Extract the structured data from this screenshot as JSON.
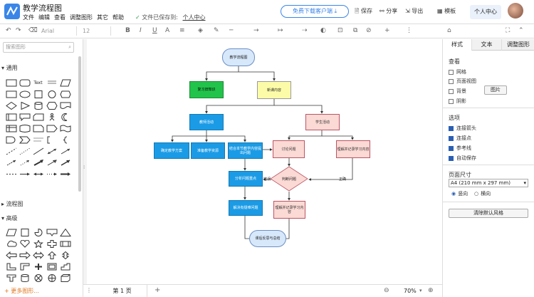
{
  "header": {
    "title": "教学流程图",
    "menu": [
      "文件",
      "编辑",
      "查看",
      "调整图形",
      "其它",
      "帮助"
    ],
    "saved_text": "文件已保存到:",
    "saved_link": "个人中心",
    "download_btn": "免费下载客户端",
    "save": "保存",
    "share": "分享",
    "export": "导出",
    "template": "模板",
    "personal_center": "个人中心"
  },
  "toolbar": {
    "font": "Arial",
    "size": "12"
  },
  "left": {
    "search_placeholder": "搜索图形",
    "section_general": "通用",
    "section_flowchart": "流程图",
    "section_advanced": "高级",
    "more_shapes": "更多图形..."
  },
  "right": {
    "tabs": [
      "样式",
      "文本",
      "调整图形"
    ],
    "view_title": "查看",
    "view_items": [
      "网格",
      "页面视图",
      "背景",
      "阴影"
    ],
    "image_btn": "图片",
    "options_title": "选项",
    "options": [
      "连接箭头",
      "连接点",
      "参考线",
      "自动保存"
    ],
    "page_size_title": "页面尺寸",
    "page_size": "A4 (210 mm x 297 mm)",
    "portrait": "竖向",
    "landscape": "横向",
    "reset_btn": "清除默认风格"
  },
  "bottom": {
    "page_tab": "第 1 页",
    "zoom": "70%"
  },
  "flow": {
    "start": "教学流程图",
    "review": "复习旧知识",
    "new": "新课内容",
    "teacher": "教师活动",
    "student": "学生活动",
    "m1": "确定教学方案",
    "m2": "准备教学资源",
    "m3": "结合本节教学内容提出问题",
    "discuss": "讨论问题",
    "summary": "理解并记录学习内容",
    "analyze": "分析问题重点",
    "judge": "判断问题",
    "wrong": "错误",
    "right": "正确",
    "solve": "解决有疑难问题",
    "understand": "理解并记录学习内容",
    "end": "课后反思与总结"
  }
}
